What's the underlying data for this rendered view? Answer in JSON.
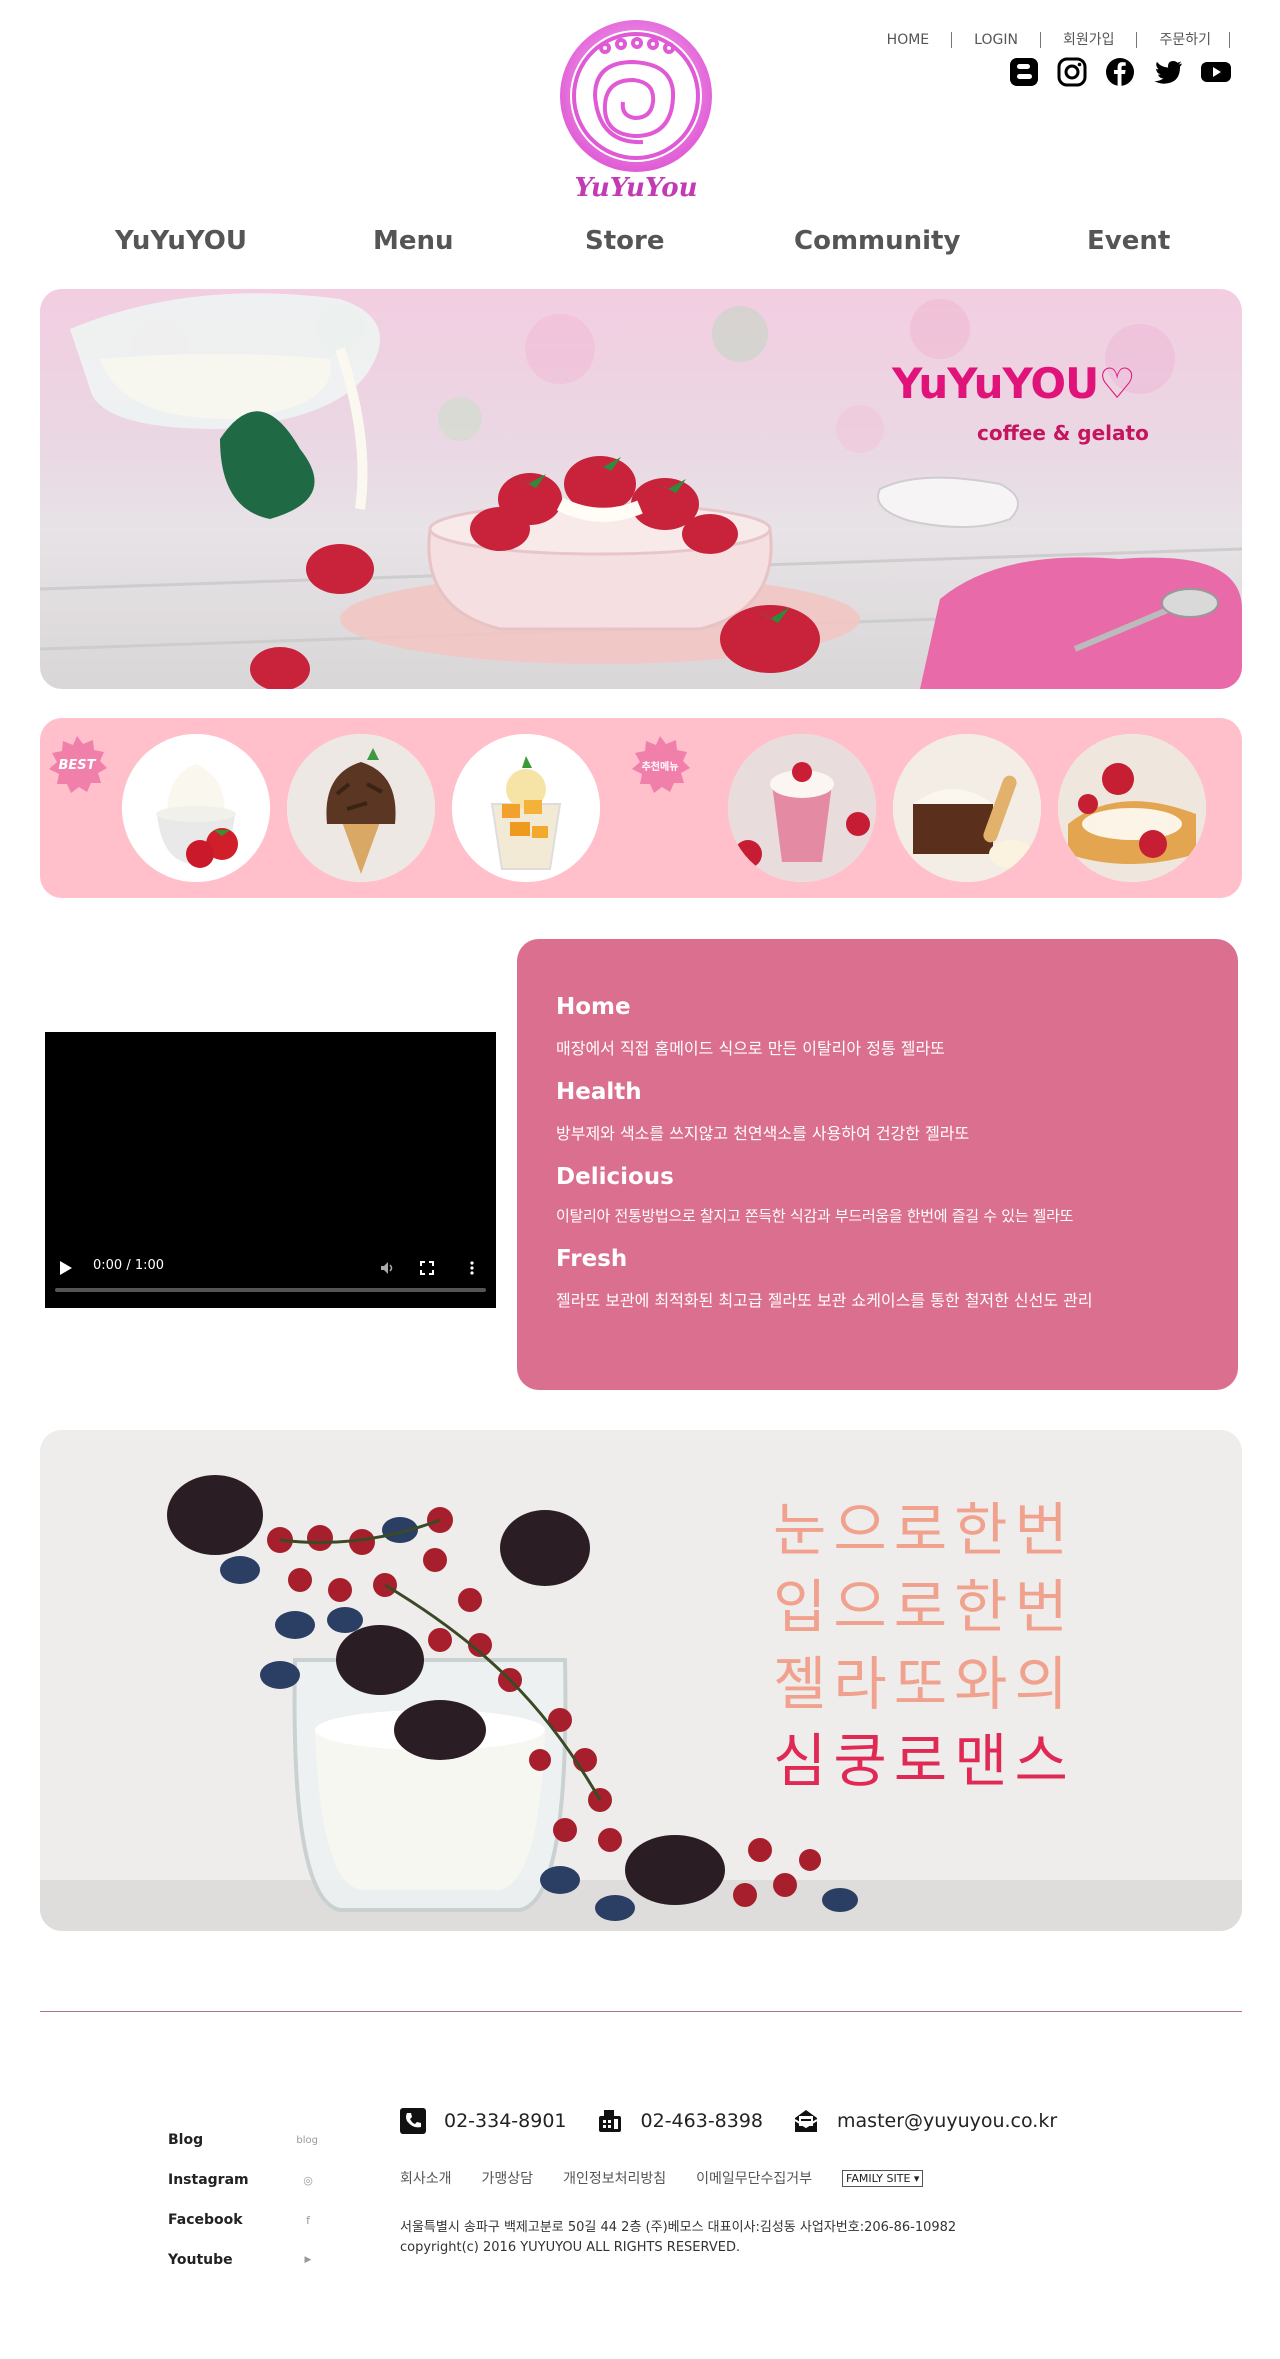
{
  "header": {
    "logo_text": "YuYuYou",
    "top_links": [
      "HOME",
      "LOGIN",
      "회원가입",
      "주문하기"
    ],
    "social_icons": [
      "blogger-icon",
      "instagram-icon",
      "facebook-icon",
      "twitter-icon",
      "youtube-icon"
    ]
  },
  "nav": {
    "items": [
      "YuYuYOU",
      "Menu",
      "Store",
      "Community",
      "Event"
    ]
  },
  "hero": {
    "brand": "YuYuYOU♡",
    "subtitle": "coffee & gelato"
  },
  "best": {
    "badge_best": "BEST",
    "badge_recommend": "추천메뉴"
  },
  "video": {
    "time": "0:00 / 1:00"
  },
  "features": [
    {
      "title": "Home",
      "text": "매장에서 직접 홈메이드 식으로 만든 이탈리아 정통 젤라또"
    },
    {
      "title": "Health",
      "text": "방부제와 색소를 쓰지않고 천연색소를 사용하여 건강한 젤라또"
    },
    {
      "title": "Delicious",
      "text": "이탈리아 전통방법으로 찰지고 쫀득한 식감과 부드러움을 한번에 즐길 수 있는 젤라또"
    },
    {
      "title": "Fresh",
      "text": "젤라또 보관에 최적화된 최고급 젤라또 보관 쇼케이스를 통한 철저한 신선도 관리"
    }
  ],
  "slogan": {
    "line1": "눈으로한번",
    "line2": "입으로한번",
    "line3": "젤라또와의",
    "line4": "심쿵로맨스"
  },
  "footer": {
    "sns": [
      {
        "label": "Blog",
        "icon_text": "blog"
      },
      {
        "label": "Instagram",
        "icon_text": "◎"
      },
      {
        "label": "Facebook",
        "icon_text": "f"
      },
      {
        "label": "Youtube",
        "icon_text": "▶"
      }
    ],
    "phone": "02-334-8901",
    "fax": "02-463-8398",
    "email": "master@yuyuyou.co.kr",
    "links": [
      "회사소개",
      "가맹상담",
      "개인정보처리방침",
      "이메일무단수집거부"
    ],
    "family_site": "FAMILY SITE",
    "address": "서울특별시 송파구 백제고분로 50길 44 2층 (주)베모스 대표이사:김성동 사업자번호:206-86-10982",
    "copyright": "copyright(c) 2016 YUYUYOU ALL RIGHTS RESERVED."
  },
  "colors": {
    "brand_pink": "#e0137a",
    "strip_pink": "#ffc0cb",
    "feature_pink": "#db6f8f",
    "slogan_peach": "#f0a28f",
    "slogan_red": "#e02a55"
  }
}
